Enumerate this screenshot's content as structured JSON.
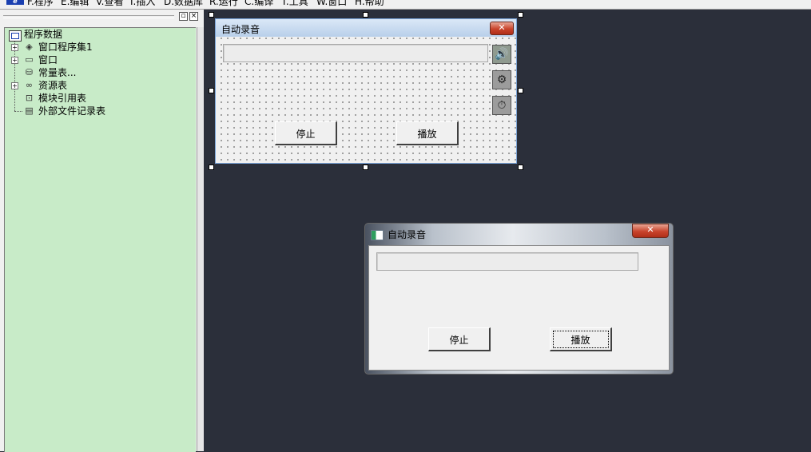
{
  "menu": {
    "items": [
      "F.程序",
      "E.编辑",
      "V.查看",
      "I.插入",
      "D.数据库",
      "R.运行",
      "C.编译",
      "T.工具",
      "W.窗口",
      "H.帮助"
    ]
  },
  "panel": {
    "restore_glyph": "▫",
    "close_glyph": "×"
  },
  "tree": {
    "root": "程序数据",
    "items": [
      {
        "label": "窗口程序集1",
        "icon": "layers-icon",
        "expandable": true
      },
      {
        "label": "窗口",
        "icon": "window-icon",
        "expandable": true
      },
      {
        "label": "常量表...",
        "icon": "constants-icon",
        "expandable": false
      },
      {
        "label": "资源表",
        "icon": "resources-icon",
        "expandable": true
      },
      {
        "label": "模块引用表",
        "icon": "module-icon",
        "expandable": false
      },
      {
        "label": "外部文件记录表",
        "icon": "file-icon",
        "expandable": false
      }
    ]
  },
  "designer": {
    "title": "自动录音",
    "close_glyph": "✕",
    "stop_label": "停止",
    "play_label": "播放",
    "tools": [
      "audio-icon",
      "selection-tool-icon",
      "timer-icon"
    ]
  },
  "preview": {
    "title": "自动录音",
    "close_glyph": "✕",
    "stop_label": "停止",
    "play_label": "播放"
  },
  "colors": {
    "workspace": "#2b2f3a",
    "tree_bg": "#c8ebc8",
    "close_red": "#c9442c"
  }
}
